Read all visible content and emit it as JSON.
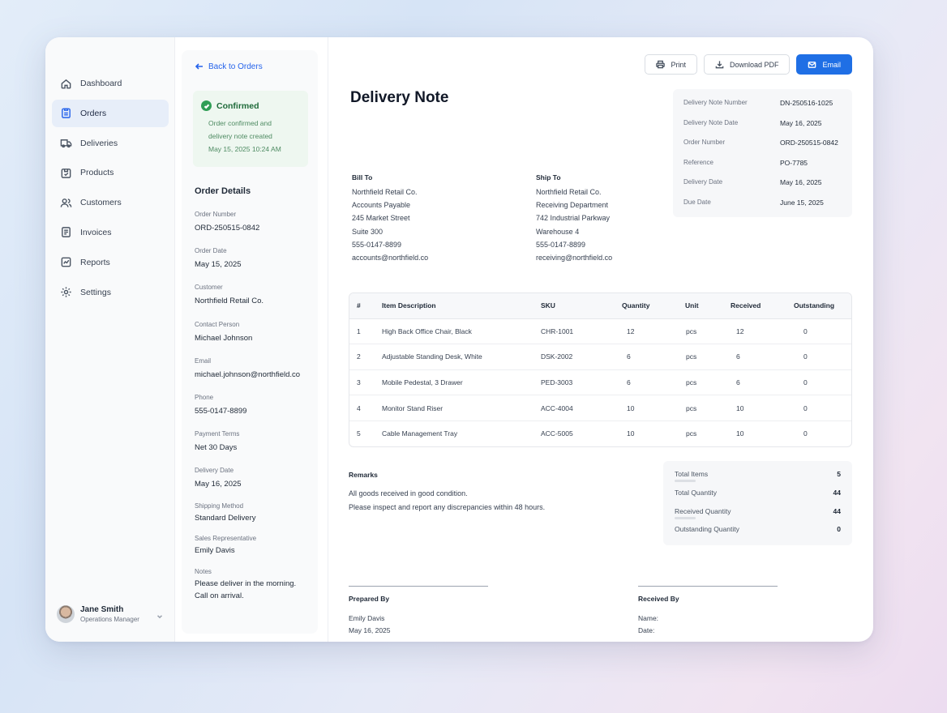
{
  "nav": [
    {
      "label": "Dashboard",
      "icon": "home-icon"
    },
    {
      "label": "Orders",
      "icon": "clipboard-icon"
    },
    {
      "label": "Deliveries",
      "icon": "truck-icon"
    },
    {
      "label": "Products",
      "icon": "box-icon"
    },
    {
      "label": "Customers",
      "icon": "users-icon"
    },
    {
      "label": "Invoices",
      "icon": "document-icon"
    },
    {
      "label": "Reports",
      "icon": "chart-icon"
    },
    {
      "label": "Settings",
      "icon": "gear-icon"
    }
  ],
  "user": {
    "name": "Jane Smith",
    "role": "Operations Manager"
  },
  "back_label": "Back to Orders",
  "status": {
    "title": "Confirmed",
    "desc_line1": "Order confirmed and",
    "desc_line2": "delivery note created",
    "time": "May 15, 2025 10:24 AM"
  },
  "order_details": {
    "title": "Order Details",
    "fields": [
      {
        "label": "Order Number",
        "value": "ORD-250515-0842"
      },
      {
        "label": "Order Date",
        "value": "May 15, 2025"
      },
      {
        "label": "Customer",
        "value": "Northfield Retail Co."
      },
      {
        "label": "Contact Person",
        "value": "Michael Johnson"
      },
      {
        "label": "Email",
        "value": "michael.johnson@northfield.co"
      },
      {
        "label": "Phone",
        "value": "555-0147-8899"
      },
      {
        "label": "Payment Terms",
        "value": "Net 30 Days"
      },
      {
        "label": "Delivery Date",
        "value": "May 16, 2025"
      },
      {
        "label": "Shipping Method",
        "value": "Standard Delivery"
      },
      {
        "label": "Sales Representative",
        "value": "Emily Davis"
      }
    ],
    "notes_label": "Notes",
    "notes_line1": "Please deliver in the morning.",
    "notes_line2": "Call on arrival."
  },
  "toolbar": {
    "print": "Print",
    "download": "Download PDF",
    "email": "Email"
  },
  "document": {
    "title": "Delivery Note",
    "meta": [
      {
        "label": "Delivery Note Number",
        "value": "DN-250516-1025"
      },
      {
        "label": "Delivery Note Date",
        "value": "May 16, 2025"
      },
      {
        "label": "Order Number",
        "value": "ORD-250515-0842"
      },
      {
        "label": "Reference",
        "value": "PO-7785"
      },
      {
        "label": "Delivery Date",
        "value": "May 16, 2025"
      },
      {
        "label": "Due Date",
        "value": "June 15, 2025"
      }
    ],
    "bill_to": {
      "title": "Bill To",
      "lines": [
        "Northfield Retail Co.",
        "Accounts Payable",
        "245 Market Street",
        "Suite 300",
        "555-0147-8899",
        "accounts@northfield.co"
      ]
    },
    "ship_to": {
      "title": "Ship To",
      "lines": [
        "Northfield Retail Co.",
        "Receiving Department",
        "742 Industrial Parkway",
        "Warehouse 4",
        "555-0147-8899",
        "receiving@northfield.co"
      ]
    },
    "table": {
      "headers": [
        "#",
        "Item Description",
        "SKU",
        "Quantity",
        "Unit",
        "Received",
        "Outstanding"
      ],
      "rows": [
        [
          "1",
          "High Back Office Chair, Black",
          "CHR-1001",
          "12",
          "pcs",
          "12",
          "0"
        ],
        [
          "2",
          "Adjustable Standing Desk, White",
          "DSK-2002",
          "6",
          "pcs",
          "6",
          "0"
        ],
        [
          "3",
          "Mobile Pedestal, 3 Drawer",
          "PED-3003",
          "6",
          "pcs",
          "6",
          "0"
        ],
        [
          "4",
          "Monitor Stand Riser",
          "ACC-4004",
          "10",
          "pcs",
          "10",
          "0"
        ],
        [
          "5",
          "Cable Management Tray",
          "ACC-5005",
          "10",
          "pcs",
          "10",
          "0"
        ]
      ]
    },
    "remarks": {
      "title": "Remarks",
      "line1": "All goods received in good condition.",
      "line2": "Please inspect and report any discrepancies within 48 hours."
    },
    "totals": [
      {
        "label": "Total Items",
        "value": "5"
      },
      {
        "label": "Total Quantity",
        "value": "44"
      },
      {
        "label": "Received Quantity",
        "value": "44"
      },
      {
        "label": "Outstanding Quantity",
        "value": "0"
      }
    ],
    "prepared_by": {
      "title": "Prepared By",
      "name": "Emily Davis",
      "date": "May 16, 2025"
    },
    "received_by": {
      "title": "Received By",
      "name_label": "Name:",
      "date_label": "Date:"
    }
  },
  "colors": {
    "accent": "#1f6fe5",
    "success": "#2f9e55",
    "success_bg": "#eef7f0"
  }
}
